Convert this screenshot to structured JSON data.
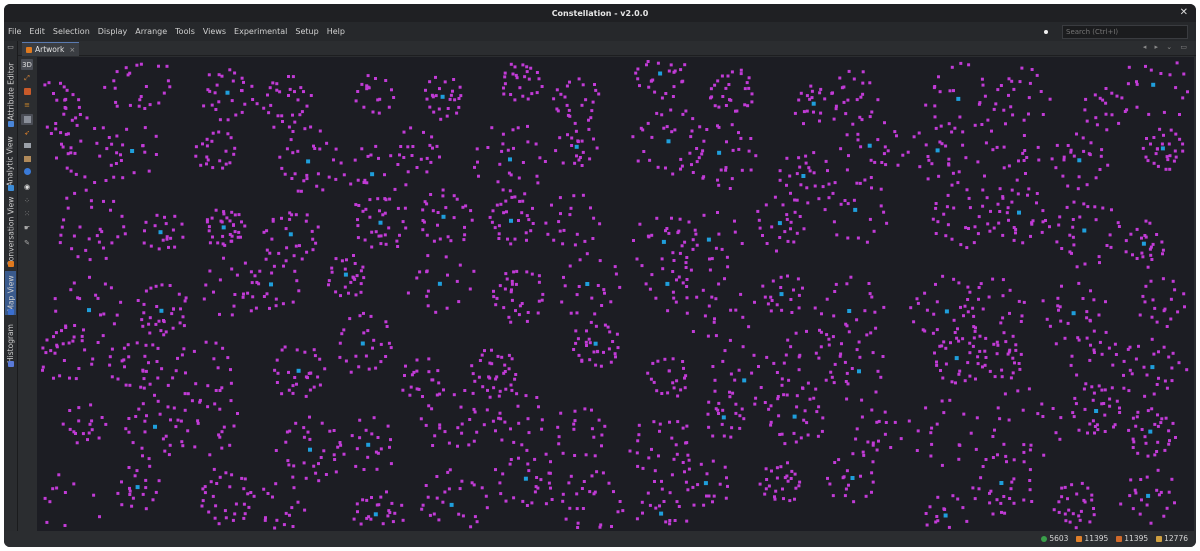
{
  "window": {
    "title": "Constellation - v2.0.0",
    "close_glyph": "✕"
  },
  "menu": [
    "File",
    "Edit",
    "Selection",
    "Display",
    "Arrange",
    "Tools",
    "Views",
    "Experimental",
    "Setup",
    "Help"
  ],
  "search": {
    "placeholder": "Search (Ctrl+I)"
  },
  "side_tabs": {
    "attribute_editor": "Attribute Editor",
    "analytic_view": "Analytic View",
    "conversation_view": "Conversation View",
    "map_view": "Map View",
    "histogram": "Histogram"
  },
  "tab": {
    "label": "Artwork",
    "close_glyph": "×",
    "controls": "◂ ▸ ⌄ ▭"
  },
  "toolbar_icons": [
    "3d-toggle-icon",
    "expand-icon",
    "nodes-icon",
    "transactions-icon",
    "labels-icon",
    "blazes-icon",
    "drawing-icon",
    "camera-icon",
    "visibility-icon",
    "select-mode-icon",
    "freeform-icon",
    "pan-icon",
    "color-picker-icon"
  ],
  "status": {
    "nodes": "5603",
    "transactions": "11395",
    "edges": "11395",
    "links": "12776"
  },
  "colors": {
    "background": "#1c1d23",
    "node": "#c13bd6",
    "hub": "#1f9fdc"
  }
}
